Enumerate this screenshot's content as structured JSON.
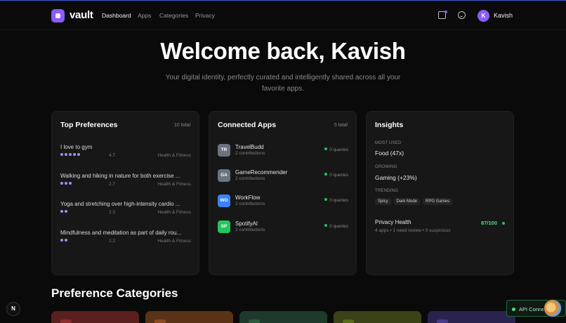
{
  "nav": {
    "brand": "vault",
    "links": [
      "Dashboard",
      "Apps",
      "Categories",
      "Privacy"
    ],
    "avatar_initial": "K",
    "user_name": "Kavish"
  },
  "hero": {
    "title": "Welcome back, Kavish",
    "subtitle": "Your digital identity, perfectly curated and intelligently shared across all your favorite apps."
  },
  "preferences": {
    "title": "Top Preferences",
    "count": "10 total",
    "items": [
      {
        "name": "I love to gym",
        "dots": 5,
        "score": "4.7",
        "category": "Health & Fitness"
      },
      {
        "name": "Walking and hiking in nature for both exercise ...",
        "dots": 3,
        "score": "2.7",
        "category": "Health & Fitness"
      },
      {
        "name": "Yoga and stretching over high-intensity cardio ...",
        "dots": 2,
        "score": "2.3",
        "category": "Health & Fitness"
      },
      {
        "name": "Mindfulness and meditation as part of daily rou...",
        "dots": 2,
        "score": "2.2",
        "category": "Health & Fitness"
      }
    ]
  },
  "apps": {
    "title": "Connected Apps",
    "count": "5 total",
    "items": [
      {
        "initials": "TR",
        "name": "TravelBudd",
        "contrib": "2 contributions",
        "status": "0 queries",
        "color": "#6b7280"
      },
      {
        "initials": "GA",
        "name": "GameRecommender",
        "contrib": "2 contributions",
        "status": "0 queries",
        "color": "#6b7280"
      },
      {
        "initials": "WO",
        "name": "WorkFlow",
        "contrib": "2 contributions",
        "status": "0 queries",
        "color": "#3b82f6"
      },
      {
        "initials": "SP",
        "name": "SpotifyAI",
        "contrib": "2 contributions",
        "status": "0 queries",
        "color": "#22c55e"
      }
    ]
  },
  "insights": {
    "title": "Insights",
    "most_used_label": "MOST USED",
    "most_used_value": "Food (47x)",
    "growing_label": "GROWING",
    "growing_value": "Gaming (+23%)",
    "trending_label": "TRENDING",
    "trending_tags": [
      "Spicy",
      "Dark Mode",
      "RPG Games"
    ],
    "privacy_label": "Privacy Health",
    "privacy_score": "87/100",
    "privacy_detail": "4 apps • 1 need review • 0 suspicious"
  },
  "categories": {
    "title": "Preference Categories",
    "colors": [
      "#5a1f1f",
      "#5a3216",
      "#1d3a2a",
      "#3a4216",
      "#2a2350"
    ],
    "chip_colors": [
      "#8b2d2d",
      "#8b4a1f",
      "#2d5a3e",
      "#5a6a1f",
      "#4a3a8a"
    ]
  },
  "footer": {
    "n_badge": "N",
    "api_status": "API Connected"
  },
  "colors": {
    "accent": "#8b5cf6",
    "success": "#22c55e"
  }
}
